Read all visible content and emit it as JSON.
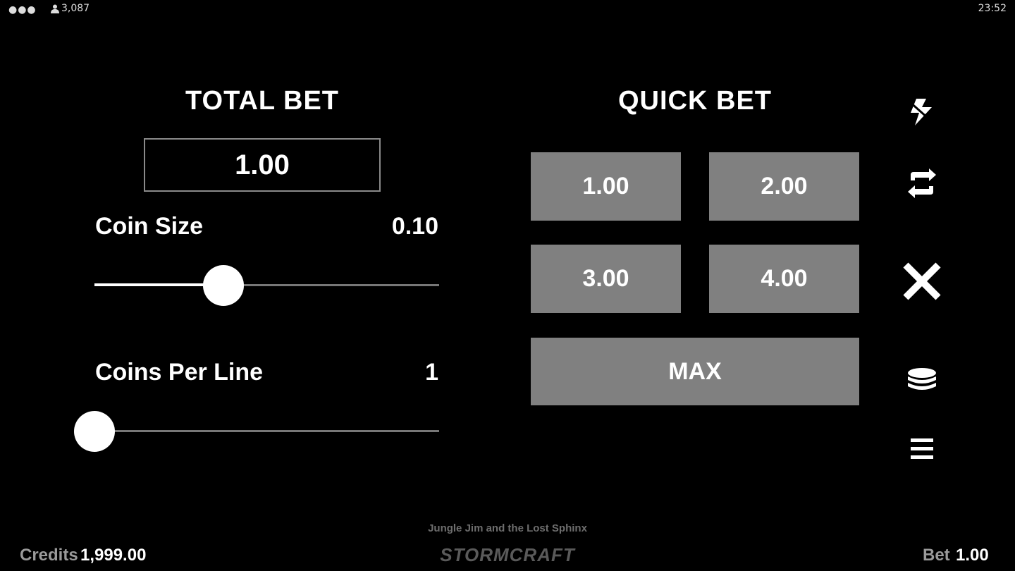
{
  "status_bar": {
    "menu_icon": "ellipsis-icon",
    "player_icon": "person-icon",
    "player_count": "3,087",
    "clock": "23:52"
  },
  "total_bet": {
    "title": "TOTAL BET",
    "value": "1.00"
  },
  "coin_size": {
    "label": "Coin Size",
    "value": "0.10",
    "slider_fraction": 0.375
  },
  "coins_per_line": {
    "label": "Coins Per Line",
    "value": "1",
    "slider_fraction": 0.0
  },
  "quick_bet": {
    "title": "QUICK BET",
    "options": [
      "1.00",
      "2.00",
      "3.00",
      "4.00"
    ],
    "max_label": "MAX"
  },
  "side_menu": {
    "icons": [
      "lightning-icon",
      "autoplay-icon",
      "close-icon",
      "coin-stack-icon",
      "menu-icon"
    ]
  },
  "footer": {
    "game_title": "Jungle Jim and the Lost Sphinx",
    "brand": "STORMCRAFT",
    "credits_label": "Credits",
    "credits_value": "1,999.00",
    "bet_label": "Bet",
    "bet_value": "1.00"
  },
  "colors": {
    "background": "#000000",
    "button": "#808080",
    "track": "#777777",
    "text": "#ffffff",
    "muted": "#9a9a9a"
  }
}
